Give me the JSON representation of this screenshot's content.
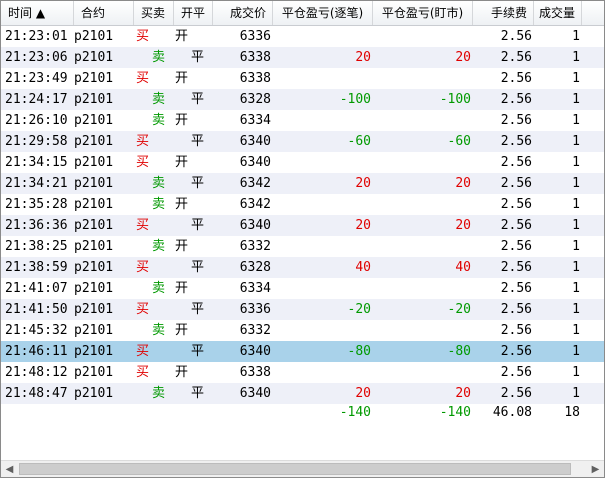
{
  "columns": {
    "time": "时间 ▲",
    "contract": "合约",
    "buy_sell": "买卖",
    "open_close": "开平",
    "price": "成交价",
    "pnl_trade": "平仓盈亏(逐笔)",
    "pnl_mark": "平仓盈亏(盯市)",
    "fee": "手续费",
    "volume": "成交量"
  },
  "rows": [
    {
      "time": "21:23:01",
      "contract": "p2101",
      "bs": "买",
      "oc": "开",
      "price": "6336",
      "pnl1": "",
      "pnl2": "",
      "fee": "2.56",
      "vol": "1"
    },
    {
      "time": "21:23:06",
      "contract": "p2101",
      "bs": "卖",
      "oc": "平",
      "price": "6338",
      "pnl1": "20",
      "pnl2": "20",
      "fee": "2.56",
      "vol": "1"
    },
    {
      "time": "21:23:49",
      "contract": "p2101",
      "bs": "买",
      "oc": "开",
      "price": "6338",
      "pnl1": "",
      "pnl2": "",
      "fee": "2.56",
      "vol": "1"
    },
    {
      "time": "21:24:17",
      "contract": "p2101",
      "bs": "卖",
      "oc": "平",
      "price": "6328",
      "pnl1": "-100",
      "pnl2": "-100",
      "fee": "2.56",
      "vol": "1"
    },
    {
      "time": "21:26:10",
      "contract": "p2101",
      "bs": "卖",
      "oc": "开",
      "price": "6334",
      "pnl1": "",
      "pnl2": "",
      "fee": "2.56",
      "vol": "1"
    },
    {
      "time": "21:29:58",
      "contract": "p2101",
      "bs": "买",
      "oc": "平",
      "price": "6340",
      "pnl1": "-60",
      "pnl2": "-60",
      "fee": "2.56",
      "vol": "1"
    },
    {
      "time": "21:34:15",
      "contract": "p2101",
      "bs": "买",
      "oc": "开",
      "price": "6340",
      "pnl1": "",
      "pnl2": "",
      "fee": "2.56",
      "vol": "1"
    },
    {
      "time": "21:34:21",
      "contract": "p2101",
      "bs": "卖",
      "oc": "平",
      "price": "6342",
      "pnl1": "20",
      "pnl2": "20",
      "fee": "2.56",
      "vol": "1"
    },
    {
      "time": "21:35:28",
      "contract": "p2101",
      "bs": "卖",
      "oc": "开",
      "price": "6342",
      "pnl1": "",
      "pnl2": "",
      "fee": "2.56",
      "vol": "1"
    },
    {
      "time": "21:36:36",
      "contract": "p2101",
      "bs": "买",
      "oc": "平",
      "price": "6340",
      "pnl1": "20",
      "pnl2": "20",
      "fee": "2.56",
      "vol": "1"
    },
    {
      "time": "21:38:25",
      "contract": "p2101",
      "bs": "卖",
      "oc": "开",
      "price": "6332",
      "pnl1": "",
      "pnl2": "",
      "fee": "2.56",
      "vol": "1"
    },
    {
      "time": "21:38:59",
      "contract": "p2101",
      "bs": "买",
      "oc": "平",
      "price": "6328",
      "pnl1": "40",
      "pnl2": "40",
      "fee": "2.56",
      "vol": "1"
    },
    {
      "time": "21:41:07",
      "contract": "p2101",
      "bs": "卖",
      "oc": "开",
      "price": "6334",
      "pnl1": "",
      "pnl2": "",
      "fee": "2.56",
      "vol": "1"
    },
    {
      "time": "21:41:50",
      "contract": "p2101",
      "bs": "买",
      "oc": "平",
      "price": "6336",
      "pnl1": "-20",
      "pnl2": "-20",
      "fee": "2.56",
      "vol": "1"
    },
    {
      "time": "21:45:32",
      "contract": "p2101",
      "bs": "卖",
      "oc": "开",
      "price": "6332",
      "pnl1": "",
      "pnl2": "",
      "fee": "2.56",
      "vol": "1"
    },
    {
      "time": "21:46:11",
      "contract": "p2101",
      "bs": "买",
      "oc": "平",
      "price": "6340",
      "pnl1": "-80",
      "pnl2": "-80",
      "fee": "2.56",
      "vol": "1",
      "selected": true
    },
    {
      "time": "21:48:12",
      "contract": "p2101",
      "bs": "买",
      "oc": "开",
      "price": "6338",
      "pnl1": "",
      "pnl2": "",
      "fee": "2.56",
      "vol": "1"
    },
    {
      "time": "21:48:47",
      "contract": "p2101",
      "bs": "卖",
      "oc": "平",
      "price": "6340",
      "pnl1": "20",
      "pnl2": "20",
      "fee": "2.56",
      "vol": "1"
    }
  ],
  "totals": {
    "pnl1": "-140",
    "pnl2": "-140",
    "fee": "46.08",
    "vol": "18"
  },
  "scrollbar": {
    "left_arrow": "◀",
    "right_arrow": "▶"
  },
  "colors": {
    "buy": "#e00000",
    "sell": "#009900",
    "profit": "#e00000",
    "loss": "#009900",
    "selected_row": "#a9d2ea",
    "alt_row": "#eef0f8"
  }
}
